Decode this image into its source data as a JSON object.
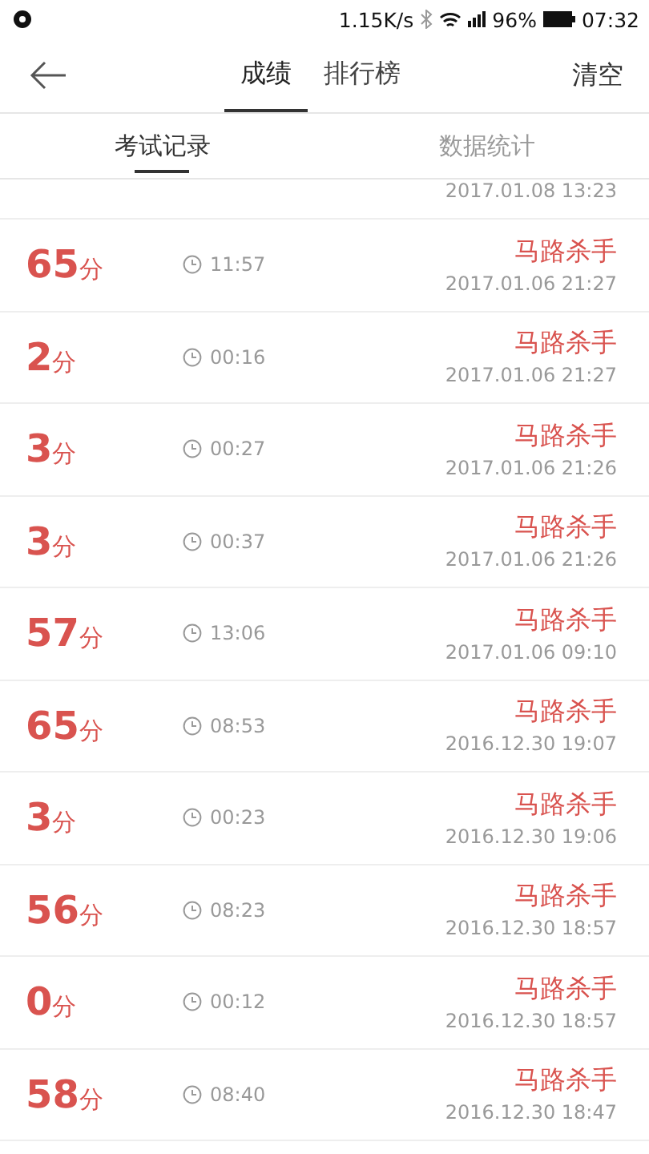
{
  "status_bar": {
    "speed": "1.15K/s",
    "battery": "96%",
    "time": "07:32"
  },
  "header": {
    "tabs": [
      {
        "label": "成绩",
        "selected": true
      },
      {
        "label": "排行榜",
        "selected": false
      }
    ],
    "action": "清空"
  },
  "subtabs": [
    {
      "label": "考试记录",
      "selected": true
    },
    {
      "label": "数据统计",
      "selected": false
    }
  ],
  "partial_row": {
    "datetime": "2017.01.08  13:23"
  },
  "records": [
    {
      "score": "65",
      "unit": "分",
      "duration": "11:57",
      "title": "马路杀手",
      "datetime": "2017.01.06  21:27"
    },
    {
      "score": "2",
      "unit": "分",
      "duration": "00:16",
      "title": "马路杀手",
      "datetime": "2017.01.06  21:27"
    },
    {
      "score": "3",
      "unit": "分",
      "duration": "00:27",
      "title": "马路杀手",
      "datetime": "2017.01.06  21:26"
    },
    {
      "score": "3",
      "unit": "分",
      "duration": "00:37",
      "title": "马路杀手",
      "datetime": "2017.01.06  21:26"
    },
    {
      "score": "57",
      "unit": "分",
      "duration": "13:06",
      "title": "马路杀手",
      "datetime": "2017.01.06  09:10"
    },
    {
      "score": "65",
      "unit": "分",
      "duration": "08:53",
      "title": "马路杀手",
      "datetime": "2016.12.30  19:07"
    },
    {
      "score": "3",
      "unit": "分",
      "duration": "00:23",
      "title": "马路杀手",
      "datetime": "2016.12.30  19:06"
    },
    {
      "score": "56",
      "unit": "分",
      "duration": "08:23",
      "title": "马路杀手",
      "datetime": "2016.12.30  18:57"
    },
    {
      "score": "0",
      "unit": "分",
      "duration": "00:12",
      "title": "马路杀手",
      "datetime": "2016.12.30  18:57"
    },
    {
      "score": "58",
      "unit": "分",
      "duration": "08:40",
      "title": "马路杀手",
      "datetime": "2016.12.30  18:47"
    }
  ]
}
